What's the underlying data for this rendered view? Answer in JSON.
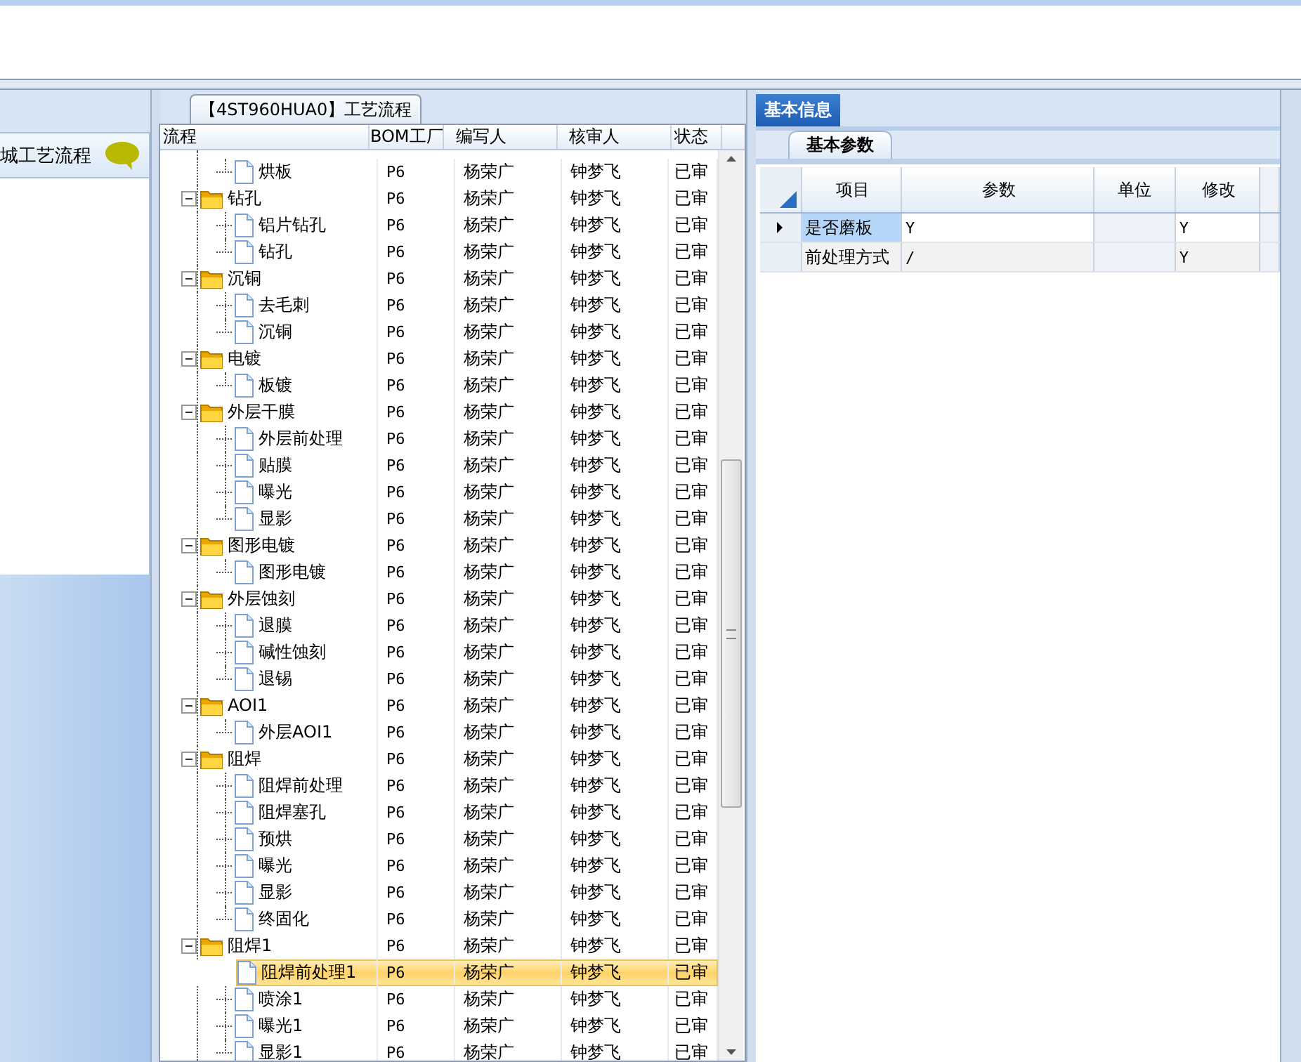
{
  "left_panel": {
    "title": "城工艺流程"
  },
  "process_panel": {
    "title": "【4ST960HUA0】工艺流程",
    "columns": [
      "流程",
      "BOM工厂",
      "编写人",
      "核审人",
      "状态"
    ],
    "rows": [
      {
        "children": [
          {
            "name": "烘板",
            "factory": "P6",
            "writer": "杨荣广",
            "reviewer": "钟梦飞",
            "status": "已审",
            "selected": false
          }
        ]
      },
      {
        "name": "钻孔",
        "expanded": true,
        "factory": "P6",
        "writer": "杨荣广",
        "reviewer": "钟梦飞",
        "status": "已审",
        "selected": false,
        "children": [
          {
            "name": "铝片钻孔",
            "factory": "P6",
            "writer": "杨荣广",
            "reviewer": "钟梦飞",
            "status": "已审",
            "selected": false
          },
          {
            "name": "钻孔",
            "factory": "P6",
            "writer": "杨荣广",
            "reviewer": "钟梦飞",
            "status": "已审",
            "selected": false
          }
        ]
      },
      {
        "name": "沉铜",
        "expanded": true,
        "factory": "P6",
        "writer": "杨荣广",
        "reviewer": "钟梦飞",
        "status": "已审",
        "selected": false,
        "children": [
          {
            "name": "去毛刺",
            "factory": "P6",
            "writer": "杨荣广",
            "reviewer": "钟梦飞",
            "status": "已审",
            "selected": false
          },
          {
            "name": "沉铜",
            "factory": "P6",
            "writer": "杨荣广",
            "reviewer": "钟梦飞",
            "status": "已审",
            "selected": false
          }
        ]
      },
      {
        "name": "电镀",
        "expanded": true,
        "factory": "P6",
        "writer": "杨荣广",
        "reviewer": "钟梦飞",
        "status": "已审",
        "selected": false,
        "children": [
          {
            "name": "板镀",
            "factory": "P6",
            "writer": "杨荣广",
            "reviewer": "钟梦飞",
            "status": "已审",
            "selected": false
          }
        ]
      },
      {
        "name": "外层干膜",
        "expanded": true,
        "factory": "P6",
        "writer": "杨荣广",
        "reviewer": "钟梦飞",
        "status": "已审",
        "selected": false,
        "children": [
          {
            "name": "外层前处理",
            "factory": "P6",
            "writer": "杨荣广",
            "reviewer": "钟梦飞",
            "status": "已审",
            "selected": false
          },
          {
            "name": "贴膜",
            "factory": "P6",
            "writer": "杨荣广",
            "reviewer": "钟梦飞",
            "status": "已审",
            "selected": false
          },
          {
            "name": "曝光",
            "factory": "P6",
            "writer": "杨荣广",
            "reviewer": "钟梦飞",
            "status": "已审",
            "selected": false
          },
          {
            "name": "显影",
            "factory": "P6",
            "writer": "杨荣广",
            "reviewer": "钟梦飞",
            "status": "已审",
            "selected": false
          }
        ]
      },
      {
        "name": "图形电镀",
        "expanded": true,
        "factory": "P6",
        "writer": "杨荣广",
        "reviewer": "钟梦飞",
        "status": "已审",
        "selected": false,
        "children": [
          {
            "name": "图形电镀",
            "factory": "P6",
            "writer": "杨荣广",
            "reviewer": "钟梦飞",
            "status": "已审",
            "selected": false
          }
        ]
      },
      {
        "name": "外层蚀刻",
        "expanded": true,
        "factory": "P6",
        "writer": "杨荣广",
        "reviewer": "钟梦飞",
        "status": "已审",
        "selected": false,
        "children": [
          {
            "name": "退膜",
            "factory": "P6",
            "writer": "杨荣广",
            "reviewer": "钟梦飞",
            "status": "已审",
            "selected": false
          },
          {
            "name": "碱性蚀刻",
            "factory": "P6",
            "writer": "杨荣广",
            "reviewer": "钟梦飞",
            "status": "已审",
            "selected": false
          },
          {
            "name": "退锡",
            "factory": "P6",
            "writer": "杨荣广",
            "reviewer": "钟梦飞",
            "status": "已审",
            "selected": false
          }
        ]
      },
      {
        "name": "AOI1",
        "expanded": true,
        "factory": "P6",
        "writer": "杨荣广",
        "reviewer": "钟梦飞",
        "status": "已审",
        "selected": false,
        "children": [
          {
            "name": "外层AOI1",
            "factory": "P6",
            "writer": "杨荣广",
            "reviewer": "钟梦飞",
            "status": "已审",
            "selected": false
          }
        ]
      },
      {
        "name": "阻焊",
        "expanded": true,
        "factory": "P6",
        "writer": "杨荣广",
        "reviewer": "钟梦飞",
        "status": "已审",
        "selected": false,
        "children": [
          {
            "name": "阻焊前处理",
            "factory": "P6",
            "writer": "杨荣广",
            "reviewer": "钟梦飞",
            "status": "已审",
            "selected": false
          },
          {
            "name": "阻焊塞孔",
            "factory": "P6",
            "writer": "杨荣广",
            "reviewer": "钟梦飞",
            "status": "已审",
            "selected": false
          },
          {
            "name": "预烘",
            "factory": "P6",
            "writer": "杨荣广",
            "reviewer": "钟梦飞",
            "status": "已审",
            "selected": false
          },
          {
            "name": "曝光",
            "factory": "P6",
            "writer": "杨荣广",
            "reviewer": "钟梦飞",
            "status": "已审",
            "selected": false
          },
          {
            "name": "显影",
            "factory": "P6",
            "writer": "杨荣广",
            "reviewer": "钟梦飞",
            "status": "已审",
            "selected": false
          },
          {
            "name": "终固化",
            "factory": "P6",
            "writer": "杨荣广",
            "reviewer": "钟梦飞",
            "status": "已审",
            "selected": false
          }
        ]
      },
      {
        "name": "阻焊1",
        "expanded": true,
        "factory": "P6",
        "writer": "杨荣广",
        "reviewer": "钟梦飞",
        "status": "已审",
        "selected": false,
        "children": [
          {
            "name": "阻焊前处理1",
            "factory": "P6",
            "writer": "杨荣广",
            "reviewer": "钟梦飞",
            "status": "已审",
            "selected": true
          },
          {
            "name": "喷涂1",
            "factory": "P6",
            "writer": "杨荣广",
            "reviewer": "钟梦飞",
            "status": "已审",
            "selected": false
          },
          {
            "name": "曝光1",
            "factory": "P6",
            "writer": "杨荣广",
            "reviewer": "钟梦飞",
            "status": "已审",
            "selected": false
          },
          {
            "name": "显影1",
            "factory": "P6",
            "writer": "杨荣广",
            "reviewer": "钟梦飞",
            "status": "已审",
            "selected": false
          }
        ]
      }
    ]
  },
  "detail_panel": {
    "tabs": [
      {
        "label": "基本信息",
        "selected": true
      }
    ],
    "subtabs": [
      {
        "label": "基本参数",
        "selected": true
      }
    ],
    "columns": [
      "项目",
      "参数",
      "单位",
      "修改"
    ],
    "rows": [
      {
        "item": "是否磨板",
        "param": "Y",
        "unit": "",
        "modify": "Y",
        "selected": true
      },
      {
        "item": "前处理方式",
        "param": "/",
        "unit": "",
        "modify": "Y",
        "selected": false
      }
    ]
  }
}
